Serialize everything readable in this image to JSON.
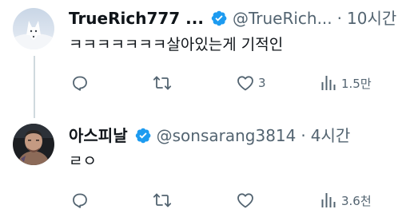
{
  "tweets": [
    {
      "display_name": "TrueRich777 ...",
      "handle": "@TrueRich...",
      "separator": "·",
      "time": "10시간",
      "text": "ㅋㅋㅋㅋㅋㅋㅋ살아있는게 기적인",
      "avatar_icon": "white-fox-avatar",
      "verified_icon": "verified-badge-icon",
      "actions": {
        "reply_count": "",
        "retweet_count": "",
        "like_count": "3",
        "view_count": "1.5만"
      }
    },
    {
      "display_name": "아스피날",
      "handle": "@sonsarang3814",
      "separator": "·",
      "time": "4시간",
      "text": "ㄹㅇ",
      "avatar_icon": "fighter-photo-avatar",
      "verified_icon": "verified-badge-icon",
      "actions": {
        "reply_count": "",
        "retweet_count": "",
        "like_count": "",
        "view_count": "3.6천"
      }
    }
  ],
  "colors": {
    "text_primary": "#0f1419",
    "text_secondary": "#536471",
    "verified_blue": "#1d9bf0",
    "thread_line": "#cfd9de"
  }
}
